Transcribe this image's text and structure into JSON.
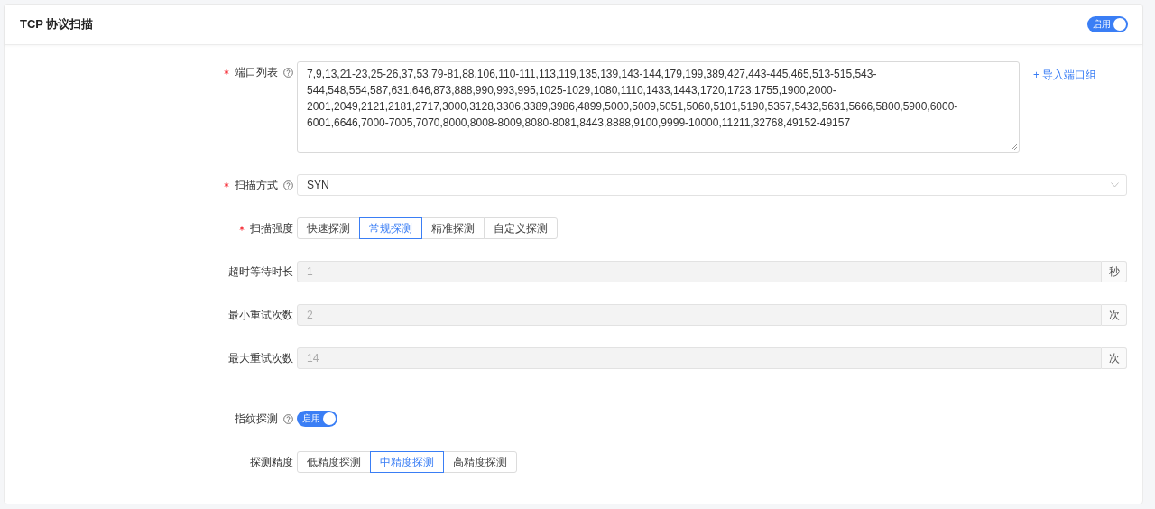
{
  "card": {
    "title": "TCP 协议扫描",
    "switch": {
      "label": "启用",
      "on": true
    }
  },
  "fields": [
    {
      "kind": "textarea",
      "label": "端口列表",
      "required": true,
      "help": true,
      "value": "7,9,13,21-23,25-26,37,53,79-81,88,106,110-111,113,119,135,139,143-144,179,199,389,427,443-445,465,513-515,543-544,548,554,587,631,646,873,888,990,993,995,1025-1029,1080,1110,1433,1443,1720,1723,1755,1900,2000-2001,2049,2121,2181,2717,3000,3128,3306,3389,3986,4899,5000,5009,5051,5060,5101,5190,5357,5432,5631,5666,5800,5900,6000-6001,6646,7000-7005,7070,8000,8008-8009,8080-8081,8443,8888,9100,9999-10000,11211,32768,49152-49157",
      "link": "+ 导入端口组"
    },
    {
      "kind": "select",
      "label": "扫描方式",
      "required": true,
      "help": true,
      "value": "SYN"
    },
    {
      "kind": "segmented",
      "label": "扫描强度",
      "required": true,
      "help": false,
      "options": [
        {
          "label": "快速探测",
          "selected": false
        },
        {
          "label": "常规探测",
          "selected": true
        },
        {
          "label": "精准探测",
          "selected": false
        },
        {
          "label": "自定义探测",
          "selected": false
        }
      ]
    },
    {
      "kind": "input",
      "label": "超时等待时长",
      "required": false,
      "help": false,
      "disabled": true,
      "value": "1",
      "suffix": "秒"
    },
    {
      "kind": "input",
      "label": "最小重试次数",
      "required": false,
      "help": false,
      "disabled": true,
      "value": "2",
      "suffix": "次"
    },
    {
      "kind": "input",
      "label": "最大重试次数",
      "required": false,
      "help": false,
      "disabled": true,
      "value": "14",
      "suffix": "次"
    },
    {
      "kind": "switch",
      "label": "指纹探测",
      "required": false,
      "help": true,
      "switch": {
        "label": "启用",
        "on": true
      }
    },
    {
      "kind": "segmented",
      "label": "探测精度",
      "required": false,
      "help": false,
      "options": [
        {
          "label": "低精度探测",
          "selected": false
        },
        {
          "label": "中精度探测",
          "selected": true
        },
        {
          "label": "高精度探测",
          "selected": false
        }
      ]
    }
  ]
}
